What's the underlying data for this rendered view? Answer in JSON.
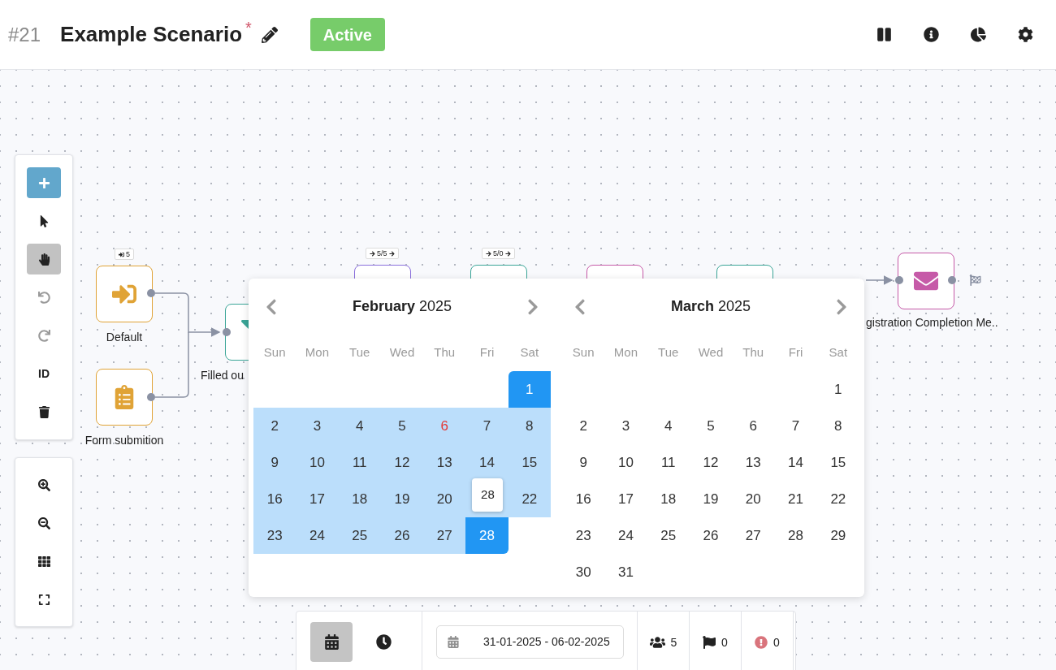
{
  "header": {
    "number": "#21",
    "title": "Example Scenario",
    "unsaved_mark": "*",
    "status": "Active",
    "actions": [
      {
        "kind": "pause"
      },
      {
        "kind": "info"
      },
      {
        "kind": "chart"
      },
      {
        "kind": "settings"
      }
    ]
  },
  "toolbar": {
    "add": {
      "kind": "add"
    },
    "modes": [
      {
        "kind": "pointer",
        "selected": false
      },
      {
        "kind": "hand",
        "selected": true
      }
    ],
    "actions": [
      {
        "kind": "undo",
        "disabled": true
      },
      {
        "kind": "redo",
        "disabled": true
      },
      {
        "kind": "text",
        "label": "ID",
        "disabled": false
      },
      {
        "kind": "delete",
        "disabled": false
      }
    ]
  },
  "zoom_tools": [
    {
      "kind": "zoom_in"
    },
    {
      "kind": "zoom_out"
    },
    {
      "kind": "grid"
    },
    {
      "kind": "fit"
    }
  ],
  "nodes": [
    {
      "kind": "entry",
      "label": "Default",
      "badge": "5",
      "color": "#e0a336"
    },
    {
      "kind": "form",
      "label": "Form submition",
      "color": "#e0a336"
    },
    {
      "kind": "filter",
      "label": "Filled ou",
      "color": "#3aa597"
    },
    {
      "kind": "covered",
      "badge": "5/5",
      "color": "#8a6fdc"
    },
    {
      "kind": "covered",
      "badge": "5/0",
      "color": "#3aa597"
    },
    {
      "kind": "covered",
      "color": "#c65aa8"
    },
    {
      "kind": "covered",
      "color": "#3aa597"
    },
    {
      "kind": "mail",
      "label": "gistration Completion Me..",
      "color": "#c65aa8"
    }
  ],
  "calendar": {
    "months": [
      {
        "month": "February",
        "year": "2025",
        "tooltip": "28",
        "weekdays": [
          "Sun",
          "Mon",
          "Tue",
          "Wed",
          "Thu",
          "Fri",
          "Sat"
        ],
        "weeks": [
          [
            {
              "label": "1",
              "selected": true,
              "in_range": true,
              "holiday": false
            }
          ],
          [
            {
              "label": "2",
              "selected": false,
              "in_range": true,
              "holiday": false
            },
            {
              "label": "3",
              "selected": false,
              "in_range": true,
              "holiday": false
            },
            {
              "label": "4",
              "selected": false,
              "in_range": true,
              "holiday": false
            },
            {
              "label": "5",
              "selected": false,
              "in_range": true,
              "holiday": false
            },
            {
              "label": "6",
              "selected": false,
              "in_range": true,
              "holiday": true
            },
            {
              "label": "7",
              "selected": false,
              "in_range": true,
              "holiday": false
            },
            {
              "label": "8",
              "selected": false,
              "in_range": true,
              "holiday": false
            }
          ],
          [
            {
              "label": "9",
              "selected": false,
              "in_range": true,
              "holiday": false
            },
            {
              "label": "10",
              "selected": false,
              "in_range": true,
              "holiday": false
            },
            {
              "label": "11",
              "selected": false,
              "in_range": true,
              "holiday": false
            },
            {
              "label": "12",
              "selected": false,
              "in_range": true,
              "holiday": false
            },
            {
              "label": "13",
              "selected": false,
              "in_range": true,
              "holiday": false
            },
            {
              "label": "14",
              "selected": false,
              "in_range": true,
              "holiday": false
            },
            {
              "label": "15",
              "selected": false,
              "in_range": true,
              "holiday": false
            }
          ],
          [
            {
              "label": "16",
              "selected": false,
              "in_range": true,
              "holiday": false
            },
            {
              "label": "17",
              "selected": false,
              "in_range": true,
              "holiday": false
            },
            {
              "label": "18",
              "selected": false,
              "in_range": true,
              "holiday": false
            },
            {
              "label": "19",
              "selected": false,
              "in_range": true,
              "holiday": false
            },
            {
              "label": "20",
              "selected": false,
              "in_range": true,
              "holiday": false
            },
            {
              "selected": false,
              "in_range": true,
              "holiday": false
            },
            {
              "label": "22",
              "selected": false,
              "in_range": true,
              "holiday": false
            }
          ],
          [
            {
              "label": "23",
              "selected": false,
              "in_range": true,
              "holiday": false
            },
            {
              "label": "24",
              "selected": false,
              "in_range": true,
              "holiday": false
            },
            {
              "label": "25",
              "selected": false,
              "in_range": true,
              "holiday": false
            },
            {
              "label": "26",
              "selected": false,
              "in_range": true,
              "holiday": false
            },
            {
              "label": "27",
              "selected": false,
              "in_range": true,
              "holiday": false
            },
            {
              "label": "28",
              "selected": true,
              "in_range": true,
              "holiday": false
            }
          ]
        ]
      },
      {
        "month": "March",
        "year": "2025",
        "weekdays": [
          "Sun",
          "Mon",
          "Tue",
          "Wed",
          "Thu",
          "Fri",
          "Sat"
        ],
        "weeks": [
          [
            {
              "label": "1",
              "selected": false,
              "in_range": false,
              "holiday": false
            }
          ],
          [
            {
              "label": "2",
              "selected": false,
              "in_range": false,
              "holiday": false
            },
            {
              "label": "3",
              "selected": false,
              "in_range": false,
              "holiday": false
            },
            {
              "label": "4",
              "selected": false,
              "in_range": false,
              "holiday": false
            },
            {
              "label": "5",
              "selected": false,
              "in_range": false,
              "holiday": false
            },
            {
              "label": "6",
              "selected": false,
              "in_range": false,
              "holiday": false
            },
            {
              "label": "7",
              "selected": false,
              "in_range": false,
              "holiday": false
            },
            {
              "label": "8",
              "selected": false,
              "in_range": false,
              "holiday": false
            }
          ],
          [
            {
              "label": "9",
              "selected": false,
              "in_range": false,
              "holiday": false
            },
            {
              "label": "10",
              "selected": false,
              "in_range": false,
              "holiday": false
            },
            {
              "label": "11",
              "selected": false,
              "in_range": false,
              "holiday": false
            },
            {
              "label": "12",
              "selected": false,
              "in_range": false,
              "holiday": false
            },
            {
              "label": "13",
              "selected": false,
              "in_range": false,
              "holiday": false
            },
            {
              "label": "14",
              "selected": false,
              "in_range": false,
              "holiday": false
            },
            {
              "label": "15",
              "selected": false,
              "in_range": false,
              "holiday": false
            }
          ],
          [
            {
              "label": "16",
              "selected": false,
              "in_range": false,
              "holiday": false
            },
            {
              "label": "17",
              "selected": false,
              "in_range": false,
              "holiday": false
            },
            {
              "label": "18",
              "selected": false,
              "in_range": false,
              "holiday": false
            },
            {
              "label": "19",
              "selected": false,
              "in_range": false,
              "holiday": false
            },
            {
              "label": "20",
              "selected": false,
              "in_range": false,
              "holiday": false
            },
            {
              "label": "21",
              "selected": false,
              "in_range": false,
              "holiday": false
            },
            {
              "label": "22",
              "selected": false,
              "in_range": false,
              "holiday": false
            }
          ],
          [
            {
              "label": "23",
              "selected": false,
              "in_range": false,
              "holiday": false
            },
            {
              "label": "24",
              "selected": false,
              "in_range": false,
              "holiday": false
            },
            {
              "label": "25",
              "selected": false,
              "in_range": false,
              "holiday": false
            },
            {
              "label": "26",
              "selected": false,
              "in_range": false,
              "holiday": false
            },
            {
              "label": "27",
              "selected": false,
              "in_range": false,
              "holiday": false
            },
            {
              "label": "28",
              "selected": false,
              "in_range": false,
              "holiday": false
            },
            {
              "label": "29",
              "selected": false,
              "in_range": false,
              "holiday": false
            }
          ],
          [
            {
              "label": "30",
              "selected": false,
              "in_range": false,
              "holiday": false
            },
            {
              "label": "31",
              "selected": false,
              "in_range": false,
              "holiday": false
            }
          ]
        ]
      }
    ]
  },
  "bottom_bar": {
    "views": [
      {
        "kind": "calendar",
        "selected": true
      },
      {
        "kind": "clock",
        "selected": false
      }
    ],
    "date_range": "31-01-2025 - 06-02-2025",
    "stats": [
      {
        "kind": "users",
        "value": "5"
      },
      {
        "kind": "flags",
        "value": "0"
      },
      {
        "kind": "errors",
        "value": "0"
      }
    ]
  }
}
